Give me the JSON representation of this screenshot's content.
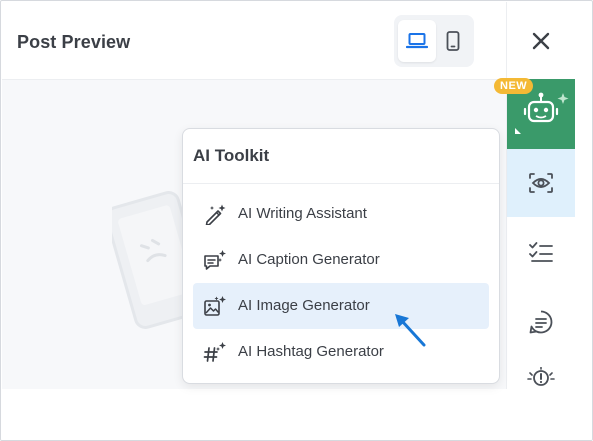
{
  "header": {
    "title": "Post Preview",
    "device_options": [
      {
        "icon": "laptop-icon",
        "selected": true
      },
      {
        "icon": "smartphone-icon",
        "selected": false
      }
    ]
  },
  "sidebar": {
    "close_icon": "close-icon",
    "items": [
      {
        "icon": "ai-robot-icon",
        "badge": "NEW",
        "active": false
      },
      {
        "icon": "eye-scan-icon",
        "active": true
      },
      {
        "icon": "checklist-icon",
        "active": false
      },
      {
        "icon": "comment-icon",
        "active": false
      },
      {
        "icon": "alert-icon",
        "active": false
      }
    ]
  },
  "ai_toolkit": {
    "title": "AI Toolkit",
    "items": [
      {
        "label": "AI Writing Assistant",
        "icon": "magic-pen-icon",
        "highlighted": false
      },
      {
        "label": "AI Caption Generator",
        "icon": "caption-sparkle-icon",
        "highlighted": false
      },
      {
        "label": "AI Image Generator",
        "icon": "image-sparkle-icon",
        "highlighted": true
      },
      {
        "label": "AI Hashtag Generator",
        "icon": "hashtag-sparkle-icon",
        "highlighted": false
      }
    ]
  },
  "colors": {
    "accent_blue": "#1a73e8",
    "ai_green": "#3a9a6a",
    "badge_yellow": "#f4b935",
    "active_row": "#e6f0fb",
    "pointer_blue": "#1877d6"
  }
}
